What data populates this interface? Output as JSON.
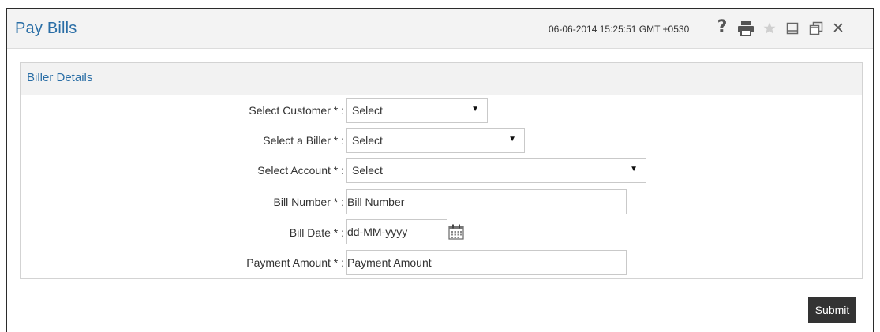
{
  "window": {
    "title": "Pay Bills",
    "timestamp": "06-06-2014 15:25:51 GMT +0530",
    "icons": [
      "help-icon",
      "print-icon",
      "star-icon",
      "minimize-icon",
      "restore-icon",
      "close-icon"
    ],
    "help_glyph": "?",
    "close_glyph": "✕"
  },
  "section": {
    "title": "Biller Details"
  },
  "form": {
    "customer": {
      "label": "Select Customer * :",
      "value": "Select"
    },
    "biller": {
      "label": "Select a Biller * :",
      "value": "Select"
    },
    "account": {
      "label": "Select Account * :",
      "value": "Select"
    },
    "bill_number": {
      "label": "Bill Number * :",
      "placeholder": "Bill Number"
    },
    "bill_date": {
      "label": "Bill Date * :",
      "placeholder": "dd-MM-yyyy"
    },
    "payment_amount": {
      "label": "Payment Amount * :",
      "placeholder": "Payment Amount"
    },
    "arrow": "▼"
  },
  "actions": {
    "submit_label": "Submit"
  },
  "colors": {
    "accent": "#2a6ea6",
    "submit_bg": "#333333",
    "header_bg": "#f3f3f3"
  }
}
